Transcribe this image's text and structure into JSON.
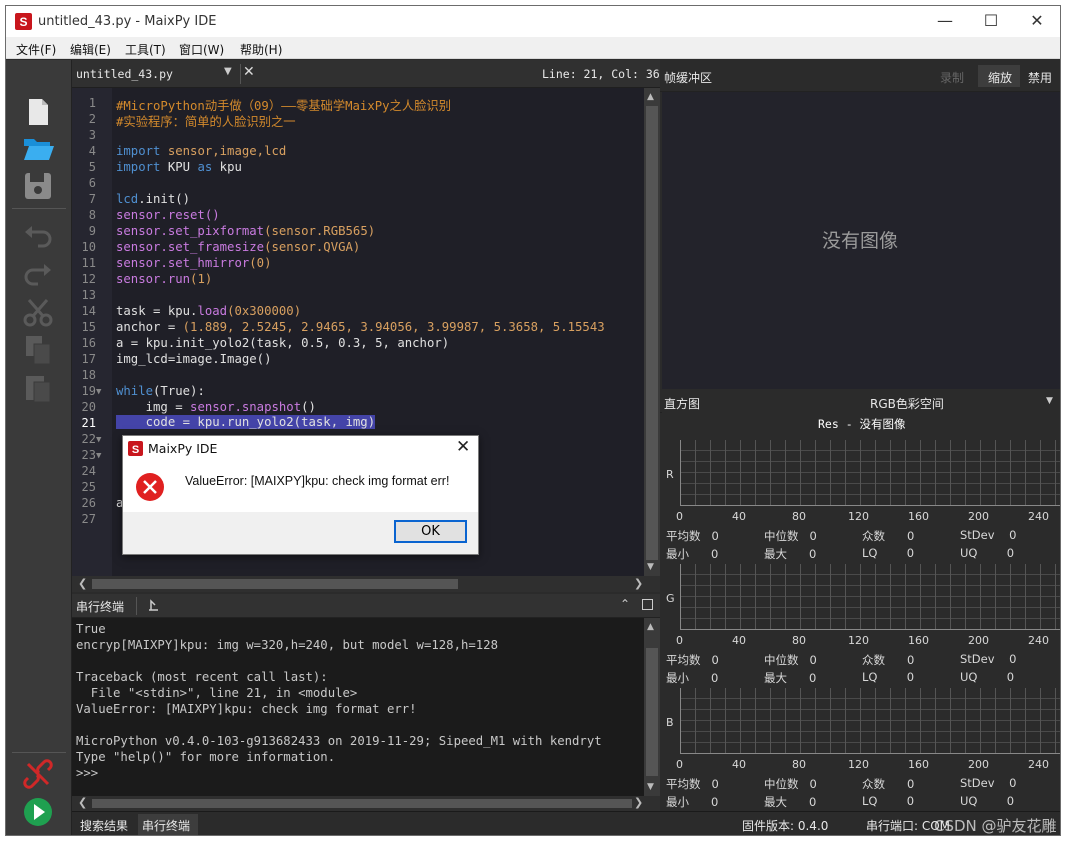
{
  "window": {
    "title": "untitled_43.py - MaixPy IDE"
  },
  "menu": [
    "文件(F)",
    "编辑(E)",
    "工具(T)",
    "窗口(W)",
    "帮助(H)"
  ],
  "tab": {
    "filename": "untitled_43.py",
    "cursor": "Line: 21, Col: 36"
  },
  "code": {
    "line_numbers": [
      "1",
      "2",
      "3",
      "4",
      "5",
      "6",
      "7",
      "8",
      "9",
      "10",
      "11",
      "12",
      "13",
      "14",
      "15",
      "16",
      "17",
      "18",
      "19",
      "20",
      "21",
      "22",
      "23",
      "24",
      "25",
      "26",
      "27"
    ],
    "l1": "#MicroPython动手做（09）——零基础学MaixPy之人脸识别",
    "l2": "#实验程序：简单的人脸识别之一",
    "l4a": "import",
    "l4b": " sensor,image,lcd",
    "l5a": "import",
    "l5b": " KPU ",
    "l5c": "as",
    "l5d": " kpu",
    "l7a": "lcd",
    "l7b": ".init()",
    "l8": "sensor.reset()",
    "l9a": "sensor.set_pixformat",
    "l9b": "(sensor.RGB565)",
    "l10a": "sensor.set_framesize",
    "l10b": "(sensor.QVGA)",
    "l11a": "sensor.set_hmirror",
    "l11b": "(0)",
    "l12a": "sensor.run",
    "l12b": "(1)",
    "l14a": "task = kpu.",
    "l14b": "load",
    "l14c": "(0x300000)",
    "l15a": "anchor = ",
    "l15b": "(1.889, 2.5245, 2.9465, 3.94056, 3.99987, 5.3658, 5.15543",
    "l16": "a = kpu.init_yolo2(task, 0.5, 0.3, 5, anchor)",
    "l17": "img_lcd=image.Image()",
    "l19a": "while",
    "l19b": "(True):",
    "l20a": "    img = ",
    "l20b": "sensor.snapshot",
    "l20c": "()",
    "l21": "    code = kpu.run_yolo2(task, img)",
    "l26": "a"
  },
  "terminal": {
    "title": "串行终端",
    "lines": [
      "True",
      "encryp[MAIXPY]kpu: img w=320,h=240, but model w=128,h=128",
      "",
      "Traceback (most recent call last):",
      "  File \"<stdin>\", line 21, in <module>",
      "ValueError: [MAIXPY]kpu: check img format err!",
      "",
      "MicroPython v0.4.0-103-g913682433 on 2019-11-29; Sipeed_M1 with kendryt",
      "Type \"help()\" for more information.",
      ">>>"
    ]
  },
  "framebuffer": {
    "title": "帧缓冲区",
    "record": "录制",
    "zoom": "缩放",
    "disable": "禁用",
    "no_image": "没有图像"
  },
  "histogram": {
    "title": "直方图",
    "colorspace": "RGB色彩空间",
    "res": "Res - 没有图像",
    "channels": [
      "R",
      "G",
      "B"
    ],
    "ticks": [
      "0",
      "40",
      "80",
      "120",
      "160",
      "200",
      "240"
    ],
    "stat_labels": {
      "mean": "平均数",
      "median": "中位数",
      "mode": "众数",
      "stdev": "StDev",
      "min": "最小",
      "max": "最大",
      "lq": "LQ",
      "uq": "UQ"
    },
    "zero": "0"
  },
  "dialog": {
    "title": "MaixPy IDE",
    "message": "ValueError: [MAIXPY]kpu: check img format err!",
    "ok": "OK"
  },
  "status": {
    "search": "搜索结果",
    "serial": "串行终端",
    "firmware": "固件版本: 0.4.0",
    "port": "串行端口: COM",
    "watermark": "CSDN @驴友花雕"
  },
  "colors": {
    "accent": "#0a64d0",
    "error": "#e02020",
    "run": "#1fa050",
    "connect": "#d02828"
  }
}
